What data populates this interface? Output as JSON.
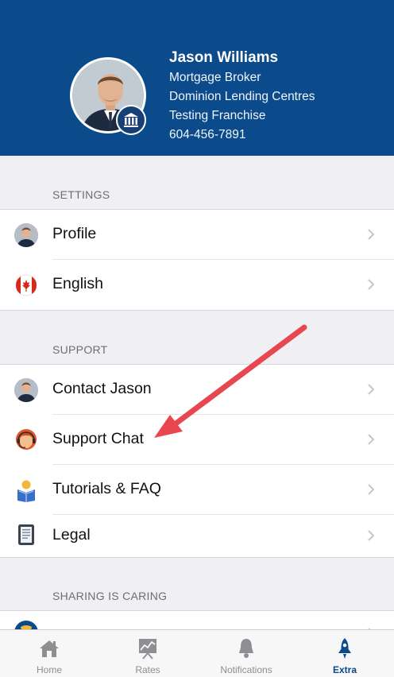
{
  "header": {
    "name": "Jason Williams",
    "title": "Mortgage Broker",
    "company": "Dominion Lending Centres",
    "franchise": "Testing Franchise",
    "phone": "604-456-7891"
  },
  "settings": {
    "title": "SETTINGS",
    "items": [
      {
        "label": "Profile",
        "icon": "profile-avatar-icon"
      },
      {
        "label": "English",
        "icon": "canada-flag-icon"
      }
    ]
  },
  "support": {
    "title": "SUPPORT",
    "items": [
      {
        "label": "Contact Jason",
        "icon": "agent-avatar-icon"
      },
      {
        "label": "Support Chat",
        "icon": "support-agent-icon"
      },
      {
        "label": "Tutorials & FAQ",
        "icon": "reading-person-icon"
      },
      {
        "label": "Legal",
        "icon": "document-icon"
      }
    ]
  },
  "sharing": {
    "title": "SHARING IS CARING"
  },
  "tabbar": {
    "tabs": [
      {
        "label": "Home",
        "icon": "home-icon"
      },
      {
        "label": "Rates",
        "icon": "chart-icon"
      },
      {
        "label": "Notifications",
        "icon": "bell-icon"
      },
      {
        "label": "Extra",
        "icon": "rocket-icon"
      }
    ],
    "active": "Extra"
  },
  "colors": {
    "header_bg": "#0b4a8b",
    "accent": "#0b4a8b",
    "annotation_arrow": "#e8474f"
  }
}
